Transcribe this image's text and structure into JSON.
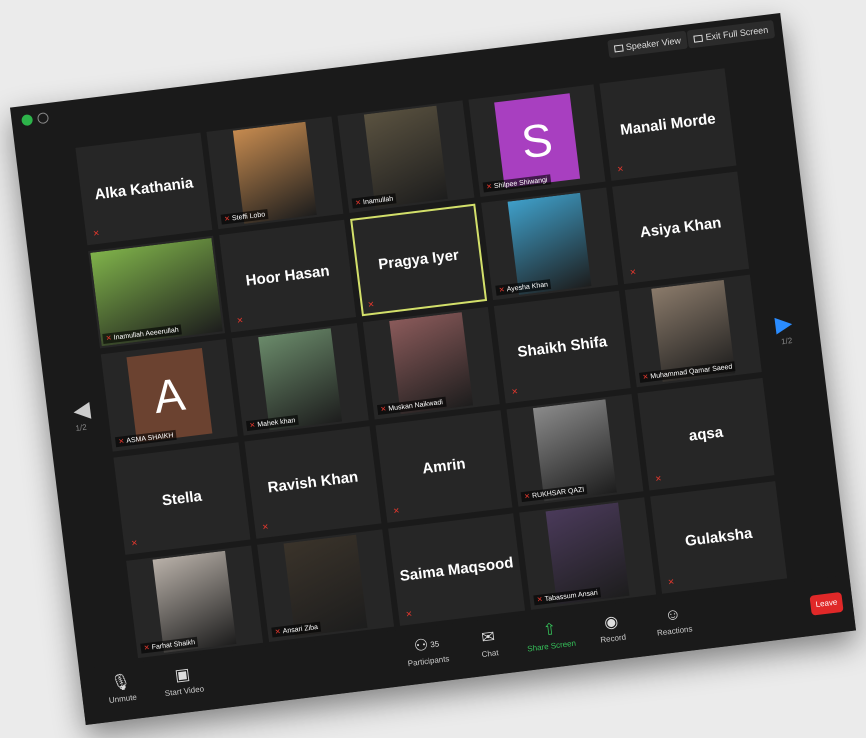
{
  "window": {
    "speaker_view": "Speaker View",
    "exit_full_screen": "Exit Full Screen",
    "page_indicator": "1/2"
  },
  "participants": [
    {
      "name": "Alka Kathania",
      "type": "name"
    },
    {
      "name": "Steffi Lobo",
      "type": "video",
      "color": "#c58a4f"
    },
    {
      "name": "Inamullah",
      "type": "video",
      "color": "#5a5240"
    },
    {
      "name": "Shilpee Shiwangi",
      "type": "avatar",
      "letter": "S",
      "color": "#a83fc0"
    },
    {
      "name": "Manali Morde",
      "type": "name"
    },
    {
      "name": "Inamullah Aeeerullah",
      "type": "video",
      "color": "#7fb24a",
      "full": true
    },
    {
      "name": "Hoor Hasan",
      "type": "name"
    },
    {
      "name": "Pragya Iyer",
      "type": "name",
      "active": true
    },
    {
      "name": "Ayesha Khan",
      "type": "video",
      "color": "#3f9fc9"
    },
    {
      "name": "Asiya Khan",
      "type": "name"
    },
    {
      "name": "ASMA SHAIKH",
      "type": "avatar",
      "letter": "A",
      "color": "#6b4230"
    },
    {
      "name": "Mahek khan",
      "type": "video",
      "color": "#6a8a6a"
    },
    {
      "name": "Muskan Naikwadi",
      "type": "video",
      "color": "#8a5a5a"
    },
    {
      "name": "Shaikh Shifa",
      "type": "name"
    },
    {
      "name": "Muhammad Qamar Saeed",
      "type": "video",
      "color": "#8a7a6a"
    },
    {
      "name": "Stella",
      "type": "name"
    },
    {
      "name": "Ravish Khan",
      "type": "name"
    },
    {
      "name": "Amrin",
      "type": "name"
    },
    {
      "name": "RUKHSAR QAZI",
      "type": "video",
      "color": "#8a8a8a"
    },
    {
      "name": "aqsa",
      "type": "name"
    },
    {
      "name": "Farhat Shaikh",
      "type": "video",
      "color": "#b8b0a8"
    },
    {
      "name": "Ansari Ziba",
      "type": "video",
      "color": "#3a332a"
    },
    {
      "name": "Saima Maqsood",
      "type": "name"
    },
    {
      "name": "Tabassum Ansari",
      "type": "video",
      "color": "#4a3a5a"
    },
    {
      "name": "Gulaksha",
      "type": "name"
    }
  ],
  "toolbar": {
    "unmute": "Unmute",
    "start_video": "Start Video",
    "participants": "Participants",
    "participant_count": "35",
    "chat": "Chat",
    "share_screen": "Share Screen",
    "record": "Record",
    "reactions": "Reactions",
    "leave": "Leave"
  },
  "colors": {
    "background": "#1a1a1a",
    "tile": "#262626",
    "active_border": "#d3e06a",
    "share_green": "#35c25a",
    "leave_red": "#e02828",
    "muted_red": "#e0372d"
  },
  "icons": {
    "mic": "mic-muted-icon",
    "video": "video-off-icon",
    "participants": "participants-icon",
    "chat": "chat-icon",
    "share": "share-screen-icon",
    "record": "record-icon",
    "reactions": "reactions-icon",
    "next": "next-page-icon",
    "prev": "prev-page-icon"
  }
}
